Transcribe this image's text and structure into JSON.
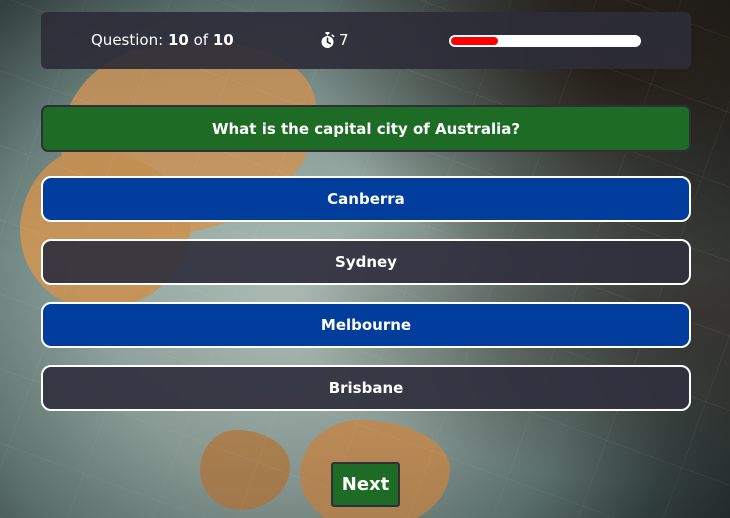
{
  "header": {
    "question_label": "Question:",
    "question_current": "10",
    "question_of": "of",
    "question_total": "10",
    "timer_icon": "stopwatch-icon",
    "timer_value": "7",
    "progress_fraction": 0.25,
    "progress_color": "#ff0000"
  },
  "question": {
    "text": "What is the capital city of Australia?"
  },
  "answers": [
    {
      "label": "Canberra",
      "color": "#003d9c"
    },
    {
      "label": "Sydney",
      "color": "#30303e"
    },
    {
      "label": "Melbourne",
      "color": "#003d9c"
    },
    {
      "label": "Brisbane",
      "color": "#30303e"
    }
  ],
  "controls": {
    "next_label": "Next"
  },
  "colors": {
    "accent_green": "#1d6b24",
    "answer_blue": "#003d9c",
    "answer_dark": "#30303e",
    "header_bg": "#2d2c38"
  }
}
